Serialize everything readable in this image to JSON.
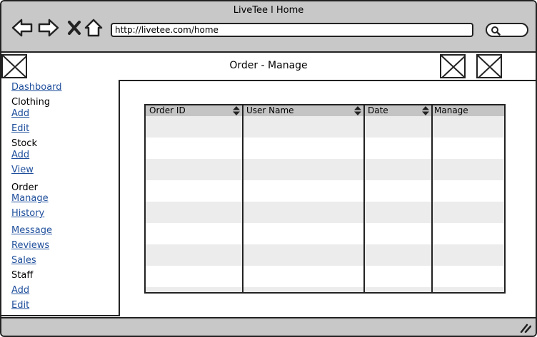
{
  "window": {
    "title": "LiveTee l Home"
  },
  "browser": {
    "url": "http://livetee.com/home",
    "back_icon": "back-arrow-icon",
    "forward_icon": "forward-arrow-icon",
    "stop_icon": "close-icon",
    "home_icon": "home-icon",
    "search_icon": "search-icon"
  },
  "header": {
    "title": "Order - Manage"
  },
  "sidebar": {
    "items": [
      {
        "label": "Dashboard",
        "type": "link"
      },
      {
        "label": "Clothing",
        "type": "heading"
      },
      {
        "label": "Add",
        "type": "link"
      },
      {
        "label": "Edit",
        "type": "link"
      },
      {
        "label": "Stock",
        "type": "heading"
      },
      {
        "label": "Add",
        "type": "link"
      },
      {
        "label": "View",
        "type": "link"
      },
      {
        "label": "Order",
        "type": "heading"
      },
      {
        "label": "Manage",
        "type": "link"
      },
      {
        "label": "History",
        "type": "link"
      },
      {
        "label": "Message",
        "type": "link"
      },
      {
        "label": "Reviews",
        "type": "link"
      },
      {
        "label": "Sales",
        "type": "link"
      },
      {
        "label": "Staff",
        "type": "heading"
      },
      {
        "label": "Add",
        "type": "link"
      },
      {
        "label": "Edit",
        "type": "link"
      }
    ]
  },
  "table": {
    "columns": [
      {
        "label": "Order ID",
        "sortable": true
      },
      {
        "label": "User Name",
        "sortable": true
      },
      {
        "label": "Date",
        "sortable": true
      },
      {
        "label": "Manage",
        "sortable": false
      }
    ],
    "rows": []
  },
  "colors": {
    "chrome": "#c8c8c8",
    "link": "#1f4f9c",
    "stripe": "#ececec",
    "table_header": "#c4c4c4"
  }
}
